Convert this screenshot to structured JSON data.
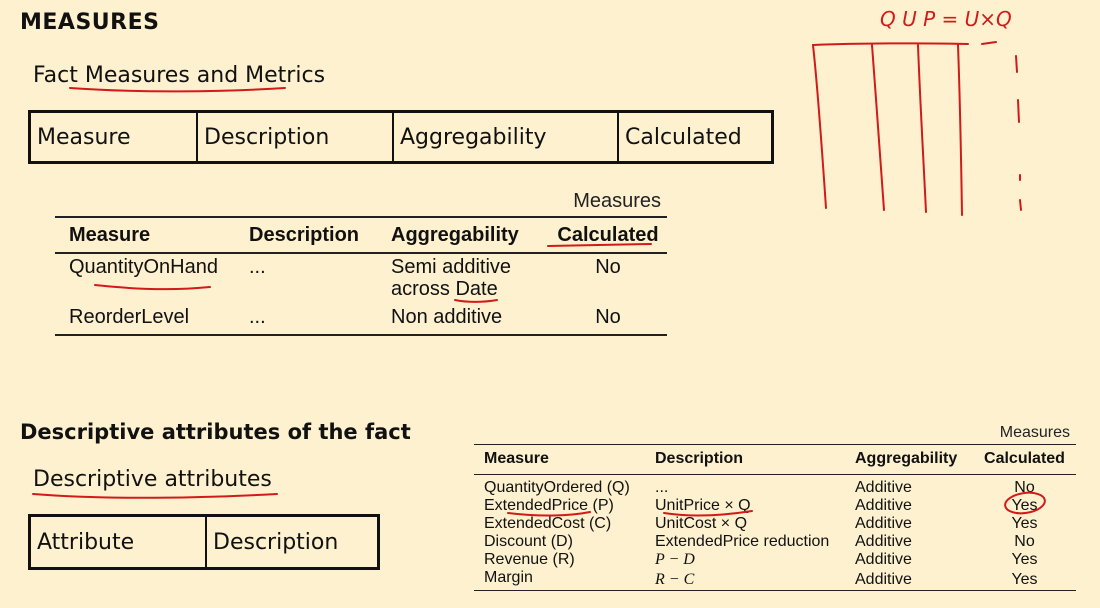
{
  "page_title": "MEASURES",
  "section1": {
    "heading": "Fact Measures and Metrics",
    "box_headers": [
      "Measure",
      "Description",
      "Aggregability",
      "Calculated"
    ]
  },
  "table1": {
    "caption": "Measures",
    "headers": [
      "Measure",
      "Description",
      "Aggregability",
      "Calculated"
    ],
    "rows": [
      {
        "measure": "QuantityOnHand",
        "description": "...",
        "aggregability_line1": "Semi additive",
        "aggregability_line2": "across Date",
        "calculated": "No"
      },
      {
        "measure": "ReorderLevel",
        "description": "...",
        "aggregability_line1": "Non additive",
        "aggregability_line2": "",
        "calculated": "No"
      }
    ]
  },
  "section2": {
    "heading": "Descriptive attributes of the fact",
    "subheading": "Descriptive attributes",
    "box_headers": [
      "Attribute",
      "Description"
    ]
  },
  "table2": {
    "caption": "Measures",
    "headers": [
      "Measure",
      "Description",
      "Aggregability",
      "Calculated"
    ],
    "rows": [
      {
        "measure": "QuantityOrdered (Q)",
        "description": "...",
        "aggregability": "Additive",
        "calculated": "No"
      },
      {
        "measure": "ExtendedPrice (P)",
        "description": "UnitPrice × Q",
        "aggregability": "Additive",
        "calculated": "Yes"
      },
      {
        "measure": "ExtendedCost (C)",
        "description": "UnitCost × Q",
        "aggregability": "Additive",
        "calculated": "Yes"
      },
      {
        "measure": "Discount (D)",
        "description": "ExtendedPrice reduction",
        "aggregability": "Additive",
        "calculated": "No"
      },
      {
        "measure": "Revenue (R)",
        "description": "P − D",
        "aggregability": "Additive",
        "calculated": "Yes"
      },
      {
        "measure": "Margin",
        "description": "R − C",
        "aggregability": "Additive",
        "calculated": "Yes"
      }
    ]
  },
  "annotation": {
    "handwritten_formula": "Q U P = U×Q"
  },
  "colors": {
    "background": "#fdf1cf",
    "ink": "#d11a1a"
  }
}
